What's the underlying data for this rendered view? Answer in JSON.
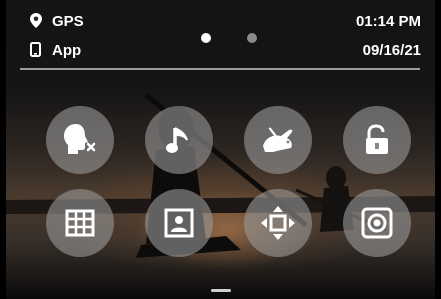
{
  "status": {
    "gps_label": "GPS",
    "app_label": "App",
    "time": "01:14 PM",
    "date": "09/16/21"
  },
  "pager": {
    "count": 2,
    "active": 1
  },
  "controls": [
    {
      "name": "voice-control-off-button",
      "icon": "voice-control-off-icon"
    },
    {
      "name": "beeps-button",
      "icon": "music-note-icon"
    },
    {
      "name": "quickcapture-button",
      "icon": "rabbit-icon"
    },
    {
      "name": "screen-lock-button",
      "icon": "unlock-icon"
    },
    {
      "name": "grid-button",
      "icon": "grid-icon"
    },
    {
      "name": "orientation-lock-button",
      "icon": "portrait-icon"
    },
    {
      "name": "hypersmooth-button",
      "icon": "move-arrows-icon"
    },
    {
      "name": "front-screen-button",
      "icon": "front-screen-icon"
    }
  ],
  "colors": {
    "text": "#ffffff",
    "button_fill": "#969696",
    "accent": "#ffffff"
  }
}
